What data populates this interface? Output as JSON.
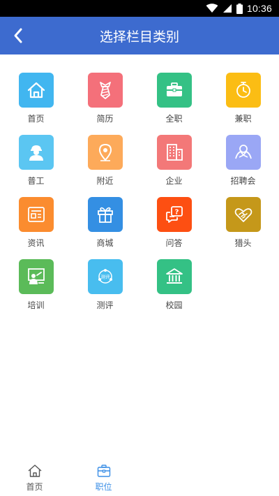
{
  "status_bar": {
    "time": "10:36"
  },
  "header": {
    "title": "选择栏目类别"
  },
  "categories": [
    {
      "label": "首页",
      "icon": "home-icon",
      "color": "#41b6f0"
    },
    {
      "label": "简历",
      "icon": "tie-icon",
      "color": "#f4707a"
    },
    {
      "label": "全职",
      "icon": "briefcase-icon",
      "color": "#34c185"
    },
    {
      "label": "兼职",
      "icon": "clock-icon",
      "color": "#fbbd14"
    },
    {
      "label": "普工",
      "icon": "worker-icon",
      "color": "#5bc6f2"
    },
    {
      "label": "附近",
      "icon": "location-pin-icon",
      "color": "#fdaa5a"
    },
    {
      "label": "企业",
      "icon": "building-icon",
      "color": "#f37878"
    },
    {
      "label": "招聘会",
      "icon": "handshake-people-icon",
      "color": "#9aa7f5"
    },
    {
      "label": "资讯",
      "icon": "news-icon",
      "color": "#fb8c2f"
    },
    {
      "label": "商城",
      "icon": "gift-icon",
      "color": "#348fe3"
    },
    {
      "label": "问答",
      "icon": "question-chat-icon",
      "color": "#fd4f12"
    },
    {
      "label": "猎头",
      "icon": "heart-handshake-icon",
      "color": "#c5981a"
    },
    {
      "label": "培训",
      "icon": "teacher-board-icon",
      "color": "#5bbb59"
    },
    {
      "label": "测评",
      "icon": "assessment-icon",
      "color": "#48bdef"
    },
    {
      "label": "校园",
      "icon": "campus-building-icon",
      "color": "#34c185"
    }
  ],
  "tabbar": {
    "items": [
      {
        "label": "首页",
        "icon": "home-outline-icon"
      },
      {
        "label": "职位",
        "icon": "briefcase-outline-icon"
      }
    ],
    "active_color": "#3a8ee6"
  },
  "colors": {
    "header": "#3d6bcf",
    "status_bar": "#000000"
  }
}
